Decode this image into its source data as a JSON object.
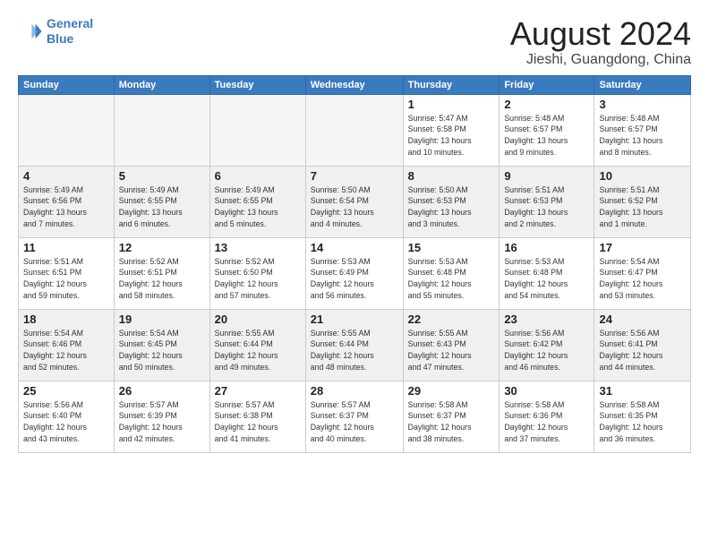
{
  "logo": {
    "line1": "General",
    "line2": "Blue"
  },
  "title": "August 2024",
  "location": "Jieshi, Guangdong, China",
  "days_of_week": [
    "Sunday",
    "Monday",
    "Tuesday",
    "Wednesday",
    "Thursday",
    "Friday",
    "Saturday"
  ],
  "weeks": [
    [
      {
        "day": "",
        "info": ""
      },
      {
        "day": "",
        "info": ""
      },
      {
        "day": "",
        "info": ""
      },
      {
        "day": "",
        "info": ""
      },
      {
        "day": "1",
        "info": "Sunrise: 5:47 AM\nSunset: 6:58 PM\nDaylight: 13 hours\nand 10 minutes."
      },
      {
        "day": "2",
        "info": "Sunrise: 5:48 AM\nSunset: 6:57 PM\nDaylight: 13 hours\nand 9 minutes."
      },
      {
        "day": "3",
        "info": "Sunrise: 5:48 AM\nSunset: 6:57 PM\nDaylight: 13 hours\nand 8 minutes."
      }
    ],
    [
      {
        "day": "4",
        "info": "Sunrise: 5:49 AM\nSunset: 6:56 PM\nDaylight: 13 hours\nand 7 minutes."
      },
      {
        "day": "5",
        "info": "Sunrise: 5:49 AM\nSunset: 6:55 PM\nDaylight: 13 hours\nand 6 minutes."
      },
      {
        "day": "6",
        "info": "Sunrise: 5:49 AM\nSunset: 6:55 PM\nDaylight: 13 hours\nand 5 minutes."
      },
      {
        "day": "7",
        "info": "Sunrise: 5:50 AM\nSunset: 6:54 PM\nDaylight: 13 hours\nand 4 minutes."
      },
      {
        "day": "8",
        "info": "Sunrise: 5:50 AM\nSunset: 6:53 PM\nDaylight: 13 hours\nand 3 minutes."
      },
      {
        "day": "9",
        "info": "Sunrise: 5:51 AM\nSunset: 6:53 PM\nDaylight: 13 hours\nand 2 minutes."
      },
      {
        "day": "10",
        "info": "Sunrise: 5:51 AM\nSunset: 6:52 PM\nDaylight: 13 hours\nand 1 minute."
      }
    ],
    [
      {
        "day": "11",
        "info": "Sunrise: 5:51 AM\nSunset: 6:51 PM\nDaylight: 12 hours\nand 59 minutes."
      },
      {
        "day": "12",
        "info": "Sunrise: 5:52 AM\nSunset: 6:51 PM\nDaylight: 12 hours\nand 58 minutes."
      },
      {
        "day": "13",
        "info": "Sunrise: 5:52 AM\nSunset: 6:50 PM\nDaylight: 12 hours\nand 57 minutes."
      },
      {
        "day": "14",
        "info": "Sunrise: 5:53 AM\nSunset: 6:49 PM\nDaylight: 12 hours\nand 56 minutes."
      },
      {
        "day": "15",
        "info": "Sunrise: 5:53 AM\nSunset: 6:48 PM\nDaylight: 12 hours\nand 55 minutes."
      },
      {
        "day": "16",
        "info": "Sunrise: 5:53 AM\nSunset: 6:48 PM\nDaylight: 12 hours\nand 54 minutes."
      },
      {
        "day": "17",
        "info": "Sunrise: 5:54 AM\nSunset: 6:47 PM\nDaylight: 12 hours\nand 53 minutes."
      }
    ],
    [
      {
        "day": "18",
        "info": "Sunrise: 5:54 AM\nSunset: 6:46 PM\nDaylight: 12 hours\nand 52 minutes."
      },
      {
        "day": "19",
        "info": "Sunrise: 5:54 AM\nSunset: 6:45 PM\nDaylight: 12 hours\nand 50 minutes."
      },
      {
        "day": "20",
        "info": "Sunrise: 5:55 AM\nSunset: 6:44 PM\nDaylight: 12 hours\nand 49 minutes."
      },
      {
        "day": "21",
        "info": "Sunrise: 5:55 AM\nSunset: 6:44 PM\nDaylight: 12 hours\nand 48 minutes."
      },
      {
        "day": "22",
        "info": "Sunrise: 5:55 AM\nSunset: 6:43 PM\nDaylight: 12 hours\nand 47 minutes."
      },
      {
        "day": "23",
        "info": "Sunrise: 5:56 AM\nSunset: 6:42 PM\nDaylight: 12 hours\nand 46 minutes."
      },
      {
        "day": "24",
        "info": "Sunrise: 5:56 AM\nSunset: 6:41 PM\nDaylight: 12 hours\nand 44 minutes."
      }
    ],
    [
      {
        "day": "25",
        "info": "Sunrise: 5:56 AM\nSunset: 6:40 PM\nDaylight: 12 hours\nand 43 minutes."
      },
      {
        "day": "26",
        "info": "Sunrise: 5:57 AM\nSunset: 6:39 PM\nDaylight: 12 hours\nand 42 minutes."
      },
      {
        "day": "27",
        "info": "Sunrise: 5:57 AM\nSunset: 6:38 PM\nDaylight: 12 hours\nand 41 minutes."
      },
      {
        "day": "28",
        "info": "Sunrise: 5:57 AM\nSunset: 6:37 PM\nDaylight: 12 hours\nand 40 minutes."
      },
      {
        "day": "29",
        "info": "Sunrise: 5:58 AM\nSunset: 6:37 PM\nDaylight: 12 hours\nand 38 minutes."
      },
      {
        "day": "30",
        "info": "Sunrise: 5:58 AM\nSunset: 6:36 PM\nDaylight: 12 hours\nand 37 minutes."
      },
      {
        "day": "31",
        "info": "Sunrise: 5:58 AM\nSunset: 6:35 PM\nDaylight: 12 hours\nand 36 minutes."
      }
    ]
  ]
}
